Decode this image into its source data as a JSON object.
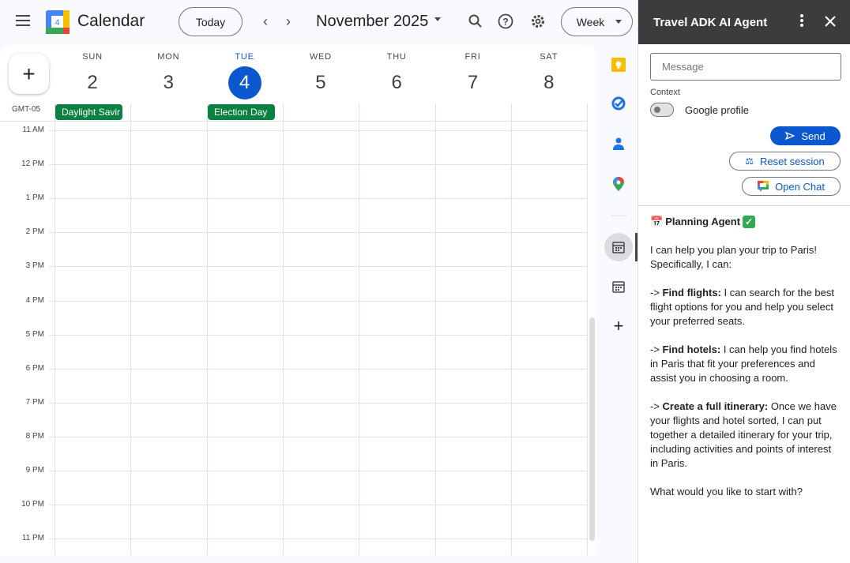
{
  "header": {
    "app_title": "Calendar",
    "logo_day": "4",
    "today_label": "Today",
    "month_label": "November 2025",
    "view_label": "Week"
  },
  "calendar": {
    "timezone": "GMT-05",
    "days": [
      {
        "dow": "SUN",
        "num": "2"
      },
      {
        "dow": "MON",
        "num": "3"
      },
      {
        "dow": "TUE",
        "num": "4",
        "today": true
      },
      {
        "dow": "WED",
        "num": "5"
      },
      {
        "dow": "THU",
        "num": "6"
      },
      {
        "dow": "FRI",
        "num": "7"
      },
      {
        "dow": "SAT",
        "num": "8"
      }
    ],
    "all_day_events": [
      {
        "title": "Daylight Saving Time ends",
        "day": 0,
        "shown": "Daylight Savir"
      },
      {
        "title": "Election Day",
        "day": 2,
        "shown": "Election Day"
      }
    ],
    "hours": [
      "11 AM",
      "12 PM",
      "1 PM",
      "2 PM",
      "3 PM",
      "4 PM",
      "5 PM",
      "6 PM",
      "7 PM",
      "8 PM",
      "9 PM",
      "10 PM",
      "11 PM"
    ],
    "today_color": "#0b57d0",
    "event_color": "#0b8043"
  },
  "side_apps": [
    "keep-icon",
    "tasks-icon",
    "contacts-icon",
    "maps-icon",
    "calendar-addon-icon",
    "calendar-icon",
    "add-icon"
  ],
  "panel": {
    "title": "Travel ADK AI Agent",
    "message_placeholder": "Message",
    "context_label": "Context",
    "toggle_label": "Google profile",
    "toggle_on": false,
    "send_label": "Send",
    "reset_label": "Reset session",
    "open_chat_label": "Open Chat",
    "agent_title": "Planning Agent",
    "intro": "I can help you plan your trip to Paris! Specifically, I can:",
    "items": [
      {
        "prefix": "-> ",
        "bold": "Find flights:",
        "text": " I can search for the best flight options for you and help you select your preferred seats."
      },
      {
        "prefix": "-> ",
        "bold": "Find hotels:",
        "text": " I can help you find hotels in Paris that fit your preferences and assist you in choosing a room."
      },
      {
        "prefix": "-> ",
        "bold": "Create a full itinerary:",
        "text": " Once we have your flights and hotel sorted, I can put together a detailed itinerary for your trip, including activities and points of interest in Paris."
      }
    ],
    "closing": "What would you like to start with?"
  }
}
